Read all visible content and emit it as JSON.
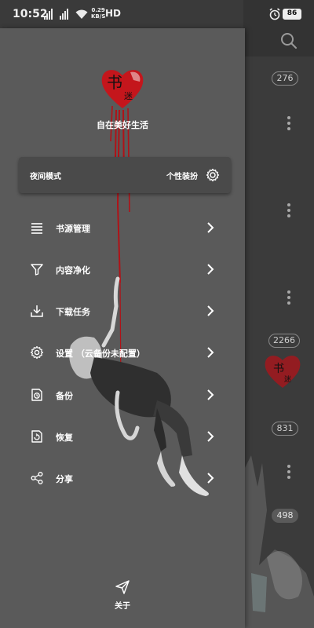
{
  "status_bar": {
    "time": "10:52",
    "net_speed_value": "0.29",
    "net_speed_unit": "KB/S",
    "network_type": "HD",
    "battery": "86"
  },
  "drawer": {
    "slogan": "自在美好生活",
    "night_mode_label": "夜间模式",
    "theme_label": "个性装扮",
    "menu": [
      {
        "label": "书源管理",
        "icon": "list-icon"
      },
      {
        "label": "内容净化",
        "icon": "filter-icon"
      },
      {
        "label": "下载任务",
        "icon": "download-icon"
      },
      {
        "label": "设置  （云备份未配置）",
        "icon": "settings-icon"
      },
      {
        "label": "备份",
        "icon": "backup-icon"
      },
      {
        "label": "恢复",
        "icon": "restore-icon"
      },
      {
        "label": "分享",
        "icon": "share-icon"
      }
    ],
    "about_label": "关于"
  },
  "background_list": {
    "badges": [
      "276",
      "2266",
      "831",
      "498"
    ]
  },
  "colors": {
    "drawer_bg": "#5a5a5a",
    "accent_red": "#c4161c",
    "text": "#ffffff"
  }
}
